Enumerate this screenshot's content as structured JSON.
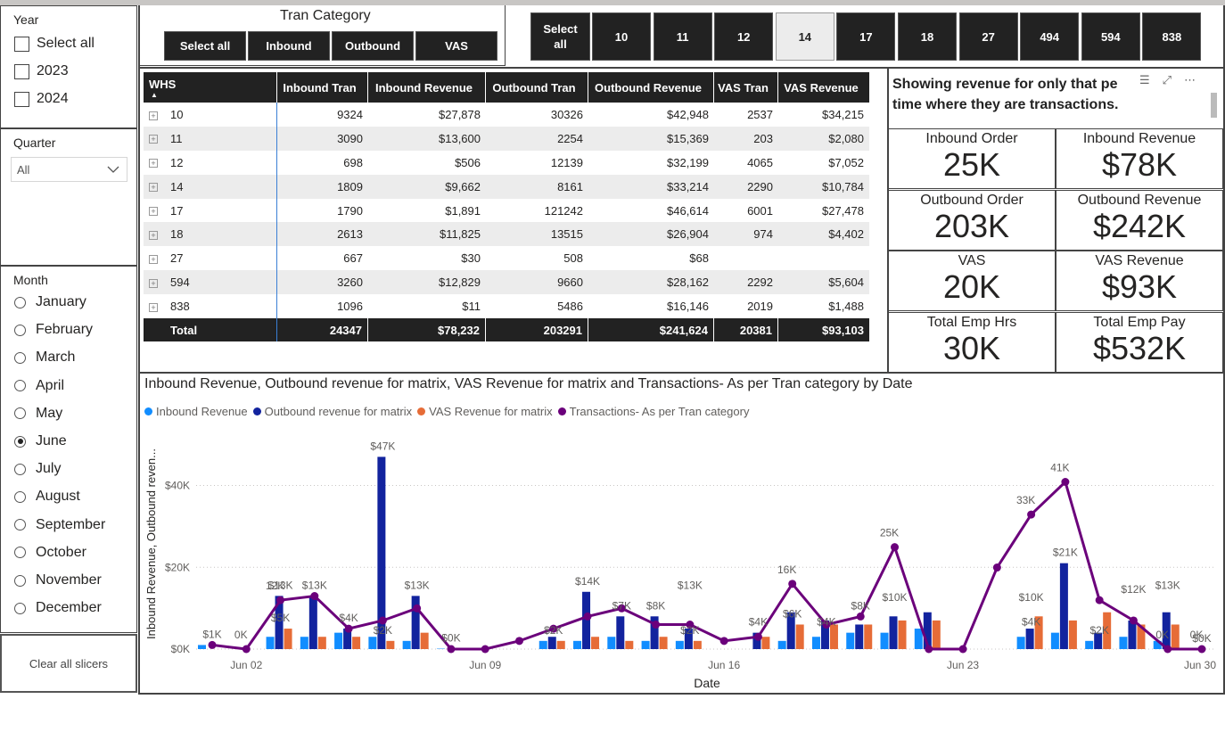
{
  "year_slicer": {
    "title": "Year",
    "items": [
      "Select all",
      "2023",
      "2024"
    ]
  },
  "quarter_slicer": {
    "title": "Quarter",
    "value": "All"
  },
  "month_slicer": {
    "title": "Month",
    "items": [
      "January",
      "February",
      "March",
      "April",
      "May",
      "June",
      "July",
      "August",
      "September",
      "October",
      "November",
      "December"
    ],
    "selected": "June"
  },
  "clear_button": "Clear all slicers",
  "tran_category": {
    "title": "Tran Category",
    "buttons": [
      "Select all",
      "Inbound",
      "Outbound",
      "VAS"
    ]
  },
  "whs_buttons": {
    "select_all": "Select all",
    "items": [
      "10",
      "11",
      "12",
      "14",
      "17",
      "18",
      "27",
      "494",
      "594",
      "838"
    ],
    "selected": "14"
  },
  "matrix": {
    "headers": [
      "WHS",
      "Inbound Tran",
      "Inbound Revenue",
      "Outbound Tran",
      "Outbound Revenue",
      "VAS Tran",
      "VAS Revenue"
    ],
    "rows": [
      [
        "10",
        "9324",
        "$27,878",
        "30326",
        "$42,948",
        "2537",
        "$34,215"
      ],
      [
        "11",
        "3090",
        "$13,600",
        "2254",
        "$15,369",
        "203",
        "$2,080"
      ],
      [
        "12",
        "698",
        "$506",
        "12139",
        "$32,199",
        "4065",
        "$7,052"
      ],
      [
        "14",
        "1809",
        "$9,662",
        "8161",
        "$33,214",
        "2290",
        "$10,784"
      ],
      [
        "17",
        "1790",
        "$1,891",
        "121242",
        "$46,614",
        "6001",
        "$27,478"
      ],
      [
        "18",
        "2613",
        "$11,825",
        "13515",
        "$26,904",
        "974",
        "$4,402"
      ],
      [
        "27",
        "667",
        "$30",
        "508",
        "$68",
        "",
        ""
      ],
      [
        "594",
        "3260",
        "$12,829",
        "9660",
        "$28,162",
        "2292",
        "$5,604"
      ],
      [
        "838",
        "1096",
        "$11",
        "5486",
        "$16,146",
        "2019",
        "$1,488"
      ]
    ],
    "total": [
      "Total",
      "24347",
      "$78,232",
      "203291",
      "$241,624",
      "20381",
      "$93,103"
    ]
  },
  "note": {
    "line1": "Showing revenue for only that pe",
    "line2": "time where they are transactions."
  },
  "kpis": [
    {
      "label": "Inbound Order",
      "value": "25K"
    },
    {
      "label": "Inbound Revenue",
      "value": "$78K"
    },
    {
      "label": "Outbound Order",
      "value": "203K"
    },
    {
      "label": "Outbound Revenue",
      "value": "$242K"
    },
    {
      "label": "VAS",
      "value": "20K"
    },
    {
      "label": "VAS Revenue",
      "value": "$93K"
    },
    {
      "label": "Total Emp Hrs",
      "value": "30K"
    },
    {
      "label": "Total Emp Pay",
      "value": "$532K"
    }
  ],
  "colors": {
    "inbound": "#118DFF",
    "outbound": "#12239E",
    "vas": "#E66C37",
    "transactions": "#6B007B",
    "dark": "#222222"
  },
  "chart_data": {
    "type": "bar",
    "title": "Inbound Revenue, Outbound revenue for matrix, VAS Revenue for matrix and Transactions- As per Tran category by Date",
    "xlabel": "Date",
    "ylabel": "Inbound Revenue, Outbound reven...",
    "ylim": [
      0,
      50000
    ],
    "yticks": [
      "$0K",
      "$20K",
      "$40K"
    ],
    "xticks": [
      "Jun 02",
      "Jun 09",
      "Jun 16",
      "Jun 23",
      "Jun 30"
    ],
    "legend_position": "top-left",
    "legend": [
      "Inbound Revenue",
      "Outbound revenue for matrix",
      "VAS Revenue for matrix",
      "Transactions- As per Tran category"
    ],
    "x": [
      1,
      2,
      3,
      4,
      5,
      6,
      7,
      8,
      9,
      10,
      11,
      12,
      13,
      14,
      15,
      16,
      17,
      18,
      19,
      20,
      21,
      22,
      23,
      24,
      25,
      26,
      27,
      28,
      29,
      30
    ],
    "series": [
      {
        "name": "Inbound Revenue",
        "values": [
          1000,
          0,
          3000,
          3000,
          4000,
          3000,
          2000,
          100,
          0,
          0,
          2000,
          2000,
          3000,
          2000,
          2000,
          0,
          0,
          2000,
          3000,
          4000,
          4000,
          5000,
          0,
          0,
          3000,
          4000,
          2000,
          3000,
          2000,
          0
        ]
      },
      {
        "name": "Outbound revenue for matrix",
        "values": [
          0,
          0,
          13000,
          13000,
          5000,
          47000,
          13000,
          0,
          0,
          0,
          3000,
          14000,
          8000,
          8000,
          5000,
          0,
          4000,
          9000,
          7000,
          6000,
          8000,
          9000,
          0,
          0,
          5000,
          21000,
          4000,
          7000,
          9000,
          0
        ]
      },
      {
        "name": "VAS Revenue for matrix",
        "values": [
          0,
          0,
          5000,
          3000,
          3000,
          2000,
          4000,
          0,
          0,
          0,
          2000,
          3000,
          2000,
          3000,
          2000,
          0,
          3000,
          6000,
          6000,
          6000,
          7000,
          7000,
          0,
          0,
          8000,
          7000,
          9000,
          6000,
          6000,
          0
        ]
      },
      {
        "name": "Transactions- As per Tran category",
        "values": [
          1,
          0,
          12,
          13,
          5,
          7,
          10,
          0,
          0,
          2,
          5,
          8,
          10,
          6,
          6,
          2,
          3,
          16,
          6,
          8,
          25,
          0,
          0,
          20,
          33,
          41,
          12,
          7,
          0,
          0
        ]
      }
    ],
    "transaction_labels": [
      "0K",
      "12K",
      "16K",
      "25K",
      "33K",
      "41K",
      "0K",
      "0K"
    ],
    "bar_labels": [
      "$1K",
      "$13K",
      "$13K",
      "$5K",
      "$4K",
      "$47K",
      "$2K",
      "$13K",
      "$0K",
      "$2K",
      "$14K",
      "$7K",
      "$8K",
      "$13K",
      "$2K",
      "$4K",
      "$6K",
      "$4K",
      "$8K",
      "$10K",
      "$10K",
      "$21K",
      "$4K",
      "$2K",
      "$12K",
      "$13K",
      "$0K"
    ]
  }
}
